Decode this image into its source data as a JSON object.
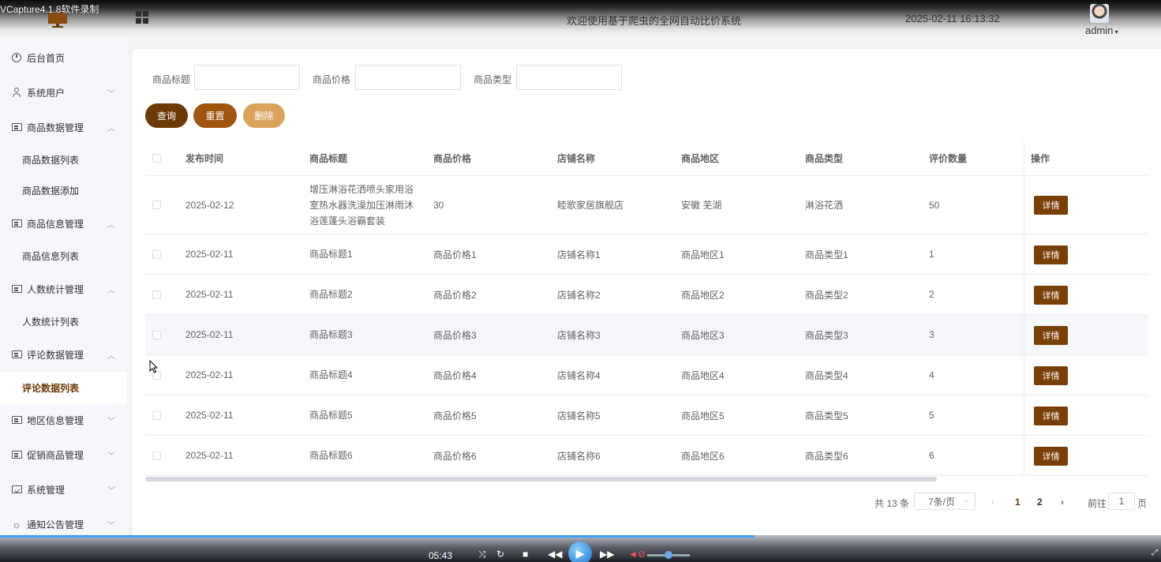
{
  "recorder": {
    "title": "VCapture4.1.8软件录制"
  },
  "header": {
    "title": "欢迎使用基于爬虫的全网自动比价系统",
    "datetime": "2025-02-11 16:13:32",
    "user": "admin"
  },
  "sidebar": {
    "items": [
      {
        "label": "后台首页",
        "icon": "clock-icon"
      },
      {
        "label": "系统用户",
        "icon": "user-icon",
        "arrow": "down"
      },
      {
        "label": "商品数据管理",
        "icon": "card-icon",
        "arrow": "up"
      },
      {
        "label": "商品数据列表",
        "sub": true
      },
      {
        "label": "商品数据添加",
        "sub": true
      },
      {
        "label": "商品信息管理",
        "icon": "card-icon",
        "arrow": "up"
      },
      {
        "label": "商品信息列表",
        "sub": true
      },
      {
        "label": "人数统计管理",
        "icon": "card-icon",
        "arrow": "up"
      },
      {
        "label": "人数统计列表",
        "sub": true
      },
      {
        "label": "评论数据管理",
        "icon": "card-icon",
        "arrow": "up"
      },
      {
        "label": "评论数据列表",
        "sub": true,
        "active": true
      },
      {
        "label": "地区信息管理",
        "icon": "card-icon",
        "arrow": "down"
      },
      {
        "label": "促销商品管理",
        "icon": "card-icon",
        "arrow": "down"
      },
      {
        "label": "系统管理",
        "icon": "folder-icon",
        "arrow": "down"
      },
      {
        "label": "通知公告管理",
        "icon": "star-icon",
        "arrow": "down"
      }
    ]
  },
  "filters": {
    "title_label": "商品标题",
    "price_label": "商品价格",
    "type_label": "商品类型"
  },
  "buttons": {
    "search": "查询",
    "reset": "重置",
    "delete": "删除"
  },
  "table": {
    "headers": [
      "发布时间",
      "商品标题",
      "商品价格",
      "店铺名称",
      "商品地区",
      "商品类型",
      "评价数量",
      "操作"
    ],
    "detail_label": "详情",
    "rows": [
      [
        "2025-02-12",
        "增压淋浴花洒喷头家用浴室热水器洗澡加压淋雨沐浴莲蓬头浴霸套装",
        "30",
        "睦歌家居旗舰店",
        "安徽 芜湖",
        "淋浴花洒",
        "50"
      ],
      [
        "2025-02-11",
        "商品标题1",
        "商品价格1",
        "店铺名称1",
        "商品地区1",
        "商品类型1",
        "1"
      ],
      [
        "2025-02-11",
        "商品标题2",
        "商品价格2",
        "店铺名称2",
        "商品地区2",
        "商品类型2",
        "2"
      ],
      [
        "2025-02-11",
        "商品标题3",
        "商品价格3",
        "店铺名称3",
        "商品地区3",
        "商品类型3",
        "3"
      ],
      [
        "2025-02-11",
        "商品标题4",
        "商品价格4",
        "店铺名称4",
        "商品地区4",
        "商品类型4",
        "4"
      ],
      [
        "2025-02-11",
        "商品标题5",
        "商品价格5",
        "店铺名称5",
        "商品地区5",
        "商品类型5",
        "5"
      ],
      [
        "2025-02-11",
        "商品标题6",
        "商品价格6",
        "店铺名称6",
        "商品地区6",
        "商品类型6",
        "6"
      ]
    ]
  },
  "pagination": {
    "total": "共 13 条",
    "page_size": "7条/页",
    "pages": [
      "1",
      "2"
    ],
    "current": "1",
    "goto_label": "前往",
    "goto_value": "1",
    "page_suffix": "页"
  },
  "player": {
    "time": "05:43",
    "progress": 0.65
  }
}
